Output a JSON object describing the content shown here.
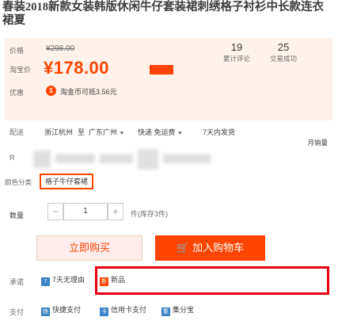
{
  "product": {
    "title": "春装2018新款女装韩版休闲牛仔套装裙刺绣格子衬衫中长款连衣裙夏"
  },
  "price_panel": {
    "original_price_label": "价格",
    "original_price": "¥298.00",
    "promo_price_label": "淘宝价",
    "promo_price": "¥178.00",
    "sales": {
      "count": "19",
      "label": "累计评论"
    },
    "deals": {
      "count": "25",
      "label": "交易成功"
    },
    "points_label": "优惠",
    "points_text": "淘金币可抵3.56元"
  },
  "shipping": {
    "label": "配送",
    "origin": "浙江杭州",
    "to_label": "至",
    "destination": "广东广州",
    "fee": "快递 免运费",
    "delivery": "7天内发货",
    "right_note": "月销量"
  },
  "style": {
    "label": "颜色分类",
    "option": "格子牛仔套裙"
  },
  "quantity": {
    "label": "数量",
    "minus": "−",
    "value": "1",
    "plus": "+",
    "stock": "件(库存3件)"
  },
  "actions": {
    "buy_label": "立即购买",
    "cart_label": "加入购物车"
  },
  "promise": {
    "label": "承诺",
    "items": [
      "7天无理由",
      "新品"
    ]
  },
  "payment": {
    "label": "支付",
    "items": [
      "快捷支付",
      "信用卡支付",
      "集分宝"
    ]
  }
}
